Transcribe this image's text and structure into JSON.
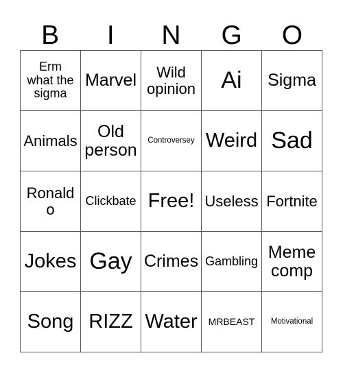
{
  "card": {
    "header_letters": [
      "B",
      "I",
      "N",
      "G",
      "O"
    ],
    "rows": [
      [
        {
          "text": "Erm\nwhat the\nsigma",
          "size": "fs-sm"
        },
        {
          "text": "Marvel",
          "size": "fs-lg"
        },
        {
          "text": "Wild\nopinion",
          "size": "fs-md"
        },
        {
          "text": "Ai",
          "size": "fs-xxl"
        },
        {
          "text": "Sigma",
          "size": "fs-lg"
        }
      ],
      [
        {
          "text": "Animals",
          "size": "fs-md"
        },
        {
          "text": "Old\nperson",
          "size": "fs-lg"
        },
        {
          "text": "Controversey",
          "size": "fs-xxs"
        },
        {
          "text": "Weird",
          "size": "fs-xl"
        },
        {
          "text": "Sad",
          "size": "fs-xxl"
        }
      ],
      [
        {
          "text": "Ronaldo",
          "size": "fs-md"
        },
        {
          "text": "Clickbate",
          "size": "fs-sm"
        },
        {
          "text": "Free!",
          "size": "fs-xl"
        },
        {
          "text": "Useless",
          "size": "fs-md"
        },
        {
          "text": "Fortnite",
          "size": "fs-md"
        }
      ],
      [
        {
          "text": "Jokes",
          "size": "fs-xl"
        },
        {
          "text": "Gay",
          "size": "fs-xxl"
        },
        {
          "text": "Crimes",
          "size": "fs-lg"
        },
        {
          "text": "Gambling",
          "size": "fs-sm"
        },
        {
          "text": "Meme\ncomp",
          "size": "fs-lg"
        }
      ],
      [
        {
          "text": "Song",
          "size": "fs-xl"
        },
        {
          "text": "RIZZ",
          "size": "fs-xl"
        },
        {
          "text": "Water",
          "size": "fs-xl"
        },
        {
          "text": "MRBEAST",
          "size": "fs-xs"
        },
        {
          "text": "Motivational",
          "size": "fs-xxs"
        }
      ]
    ]
  },
  "colors": {
    "background": "#ffffff",
    "text": "#000000",
    "grid_line": "#555555"
  }
}
